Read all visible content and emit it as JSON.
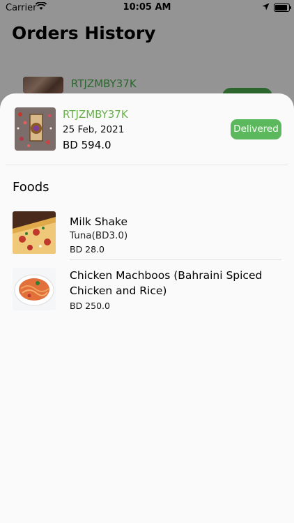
{
  "status_bar": {
    "carrier": "Carrier",
    "time": "10:05 AM"
  },
  "page": {
    "title": "Orders History"
  },
  "background_order": {
    "code": "RTJZMBY37K"
  },
  "order": {
    "code": "RTJZMBY37K",
    "date": "25 Feb, 2021",
    "total": "BD 594.0",
    "status": "Delivered",
    "status_color": "#5cb85c",
    "code_color": "#6ab04c"
  },
  "section": {
    "title": "Foods"
  },
  "foods": [
    {
      "name": "Milk Shake",
      "option": "Tuna(BD3.0)",
      "price": "BD 28.0",
      "image": "pizza-photo"
    },
    {
      "name": "Chicken Machboos (Bahraini Spiced Chicken and Rice)",
      "option": "",
      "price": "BD 250.0",
      "image": "spaghetti-photo"
    }
  ]
}
